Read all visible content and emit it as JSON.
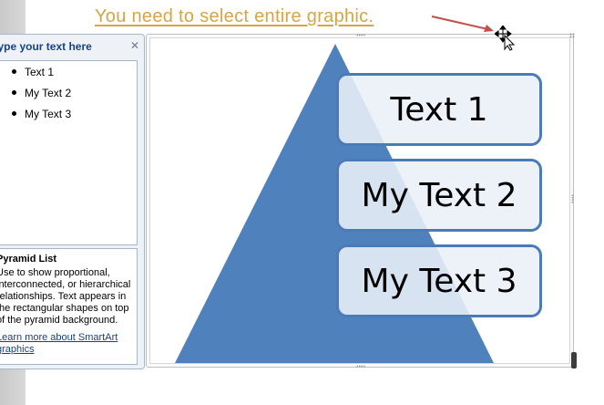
{
  "callout": {
    "text": "You need to select entire graphic.",
    "color": "#d9a441",
    "arrow_color": "#c0504d"
  },
  "text_pane": {
    "title": "Type your text here",
    "items": [
      "Text 1",
      "My Text 2",
      "My Text 3"
    ],
    "layout_name": "Pyramid List",
    "description": "Use to show proportional, interconnected, or hierarchical relationships. Text appears in the rectangular shapes on top of the pyramid background.",
    "learn_more": "Learn more about SmartArt graphics"
  },
  "smartart": {
    "shapes": [
      "Text 1",
      "My Text 2",
      "My Text 3"
    ],
    "pyramid_color": "#4f81bd",
    "box_border_color": "#4a7ab8"
  },
  "icons": [
    "move-cursor-icon",
    "close-icon",
    "bullet-icon",
    "arrow-icon"
  ]
}
